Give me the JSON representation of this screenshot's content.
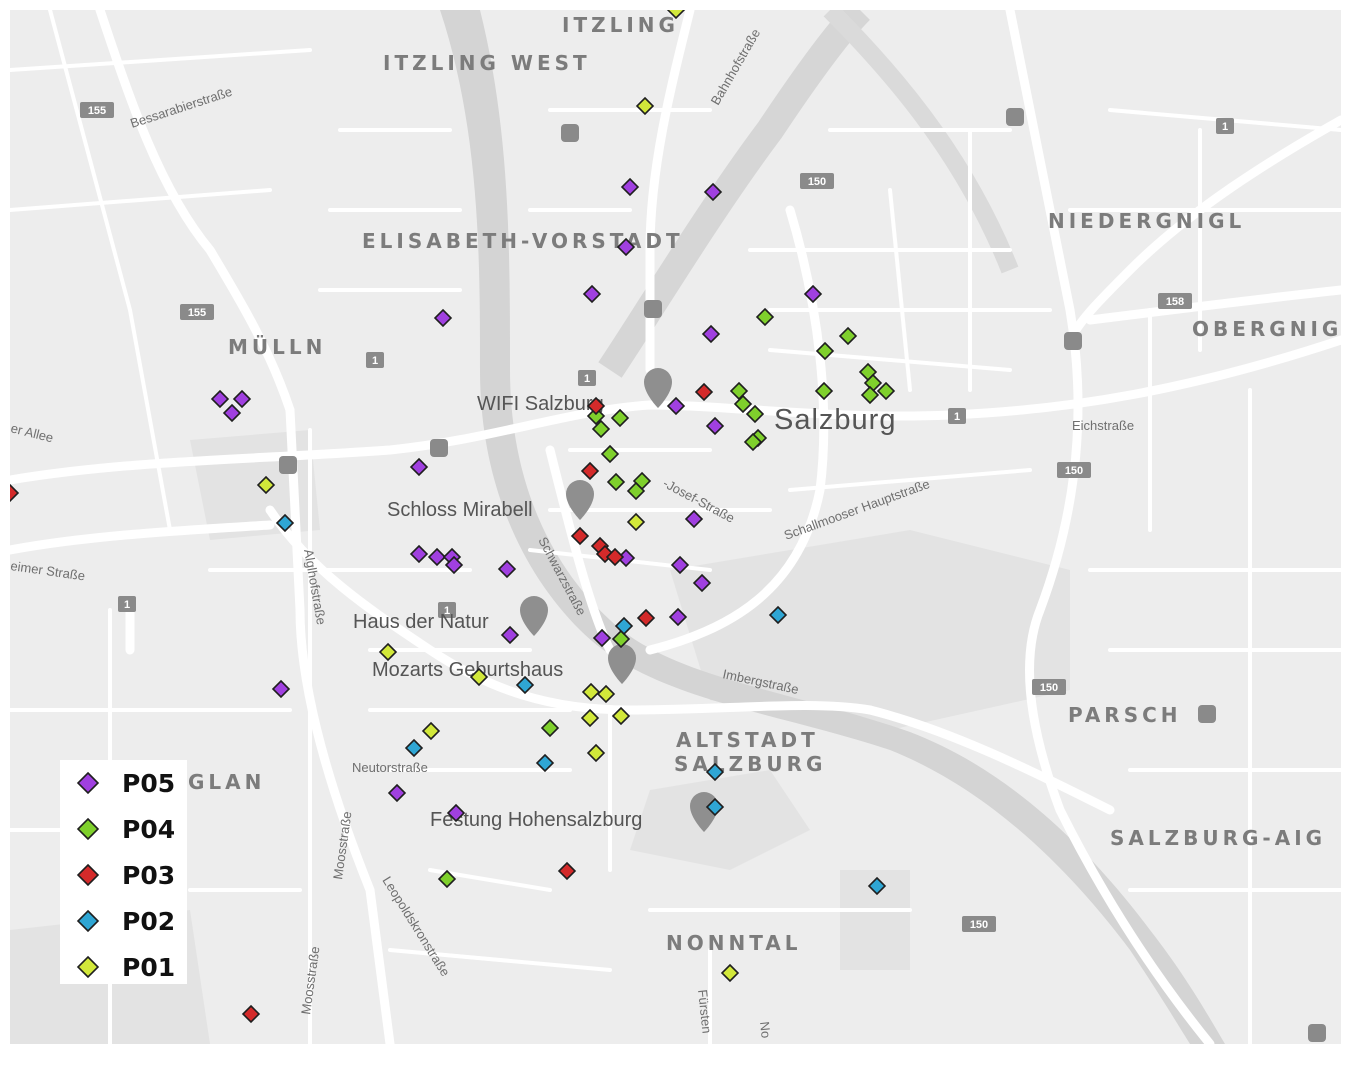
{
  "map": {
    "districts": [
      "ITZLING",
      "ITZLING WEST",
      "ELISABETH-VORSTADT",
      "NIEDERGNIGL",
      "MÜLLN",
      "OBERGNIGL",
      "PARSCH",
      "ALTSTADT",
      "SALZBURG",
      "SALZBURG-AIG",
      "GLAN",
      "NONNTAL"
    ],
    "city": "Salzburg",
    "streets": [
      "Bessarabierstraße",
      "Bahnhofstraße",
      "er Allee",
      "eimer Straße",
      "Alglhofstraße",
      "Eichstraße",
      "Schallmooser Hauptstraße",
      "-Josef-Straße",
      "Schwarzstraße",
      "Imbergstraße",
      "Neutorstraße",
      "Moosstraße",
      "Moosstraße",
      "Leopoldskronstraße",
      "Fürsten",
      "No"
    ],
    "pois": [
      "WIFI Salzburg",
      "Schloss Mirabell",
      "Haus der Natur",
      "Mozarts Geburtshaus",
      "Festung Hohensalzburg"
    ],
    "route_shields": [
      "155",
      "155",
      "150",
      "1",
      "1",
      "1",
      "1",
      "158",
      "150",
      "150",
      "150",
      "1",
      "1"
    ]
  },
  "legend": [
    {
      "key": "P05",
      "label": "P05",
      "color": "#a040e0"
    },
    {
      "key": "P04",
      "label": "P04",
      "color": "#7fd02c"
    },
    {
      "key": "P03",
      "label": "P03",
      "color": "#d42a2a"
    },
    {
      "key": "P02",
      "label": "P02",
      "color": "#2fa6d4"
    },
    {
      "key": "P01",
      "label": "P01",
      "color": "#d2e83a"
    }
  ],
  "series_colors": {
    "P05": "#a040e0",
    "P04": "#7fd02c",
    "P03": "#d42a2a",
    "P02": "#2fa6d4",
    "P01": "#d2e83a"
  }
}
